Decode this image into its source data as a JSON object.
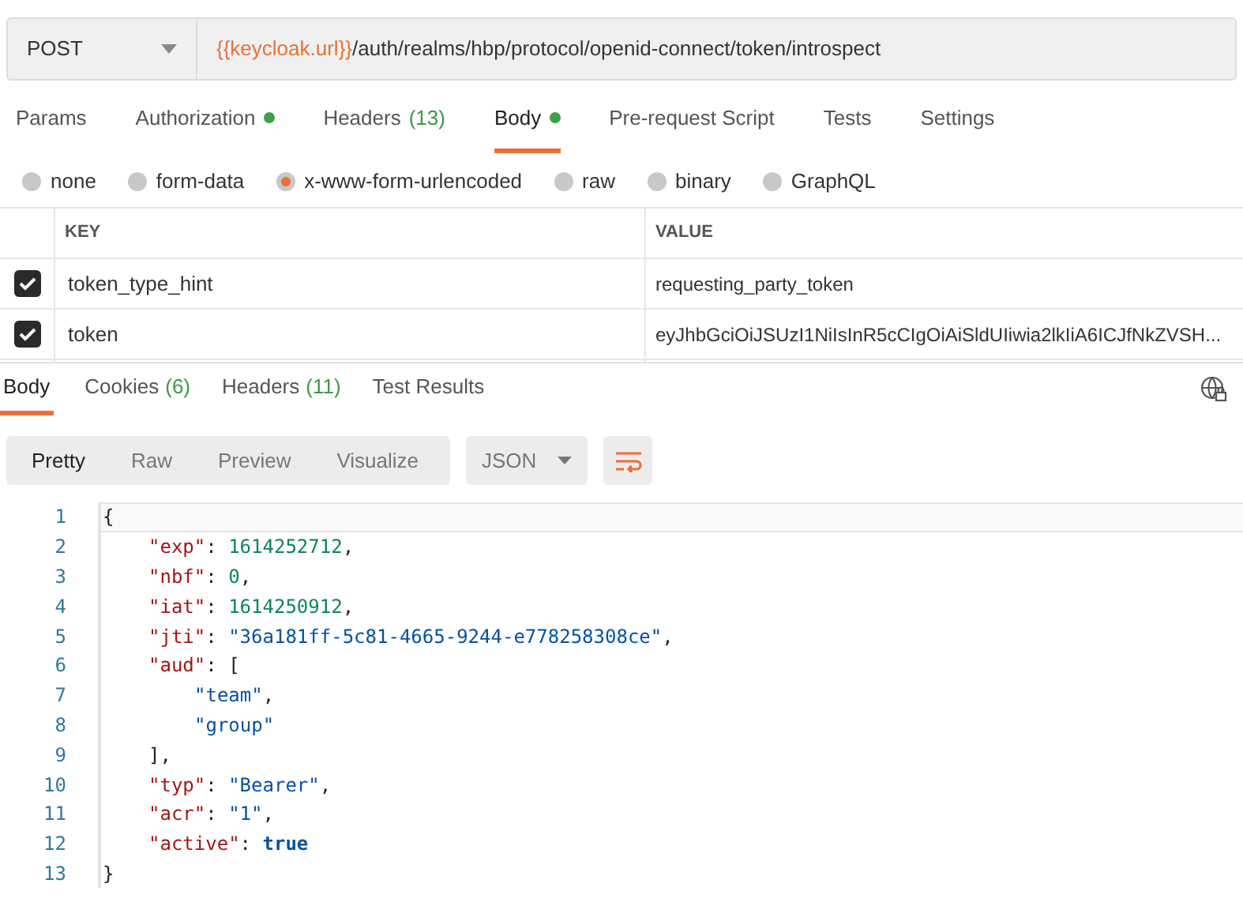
{
  "request": {
    "method": "POST",
    "url_variable": "{{keycloak.url}}",
    "url_path": "/auth/realms/hbp/protocol/openid-connect/token/introspect"
  },
  "request_tabs": [
    {
      "label": "Params",
      "selected": false,
      "dot": false
    },
    {
      "label": "Authorization",
      "selected": false,
      "dot": true
    },
    {
      "label": "Headers",
      "count": "(13)",
      "selected": false,
      "dot": false
    },
    {
      "label": "Body",
      "selected": true,
      "dot": true
    },
    {
      "label": "Pre-request Script",
      "selected": false,
      "dot": false
    },
    {
      "label": "Tests",
      "selected": false,
      "dot": false
    },
    {
      "label": "Settings",
      "selected": false,
      "dot": false
    }
  ],
  "body_types": [
    {
      "label": "none",
      "selected": false
    },
    {
      "label": "form-data",
      "selected": false
    },
    {
      "label": "x-www-form-urlencoded",
      "selected": true
    },
    {
      "label": "raw",
      "selected": false
    },
    {
      "label": "binary",
      "selected": false
    },
    {
      "label": "GraphQL",
      "selected": false
    }
  ],
  "params_table": {
    "columns": [
      "KEY",
      "VALUE"
    ],
    "rows": [
      {
        "checked": true,
        "key": "token_type_hint",
        "value": "requesting_party_token"
      },
      {
        "checked": true,
        "key": "token",
        "value": "eyJhbGciOiJSUzI1NiIsInR5cCIgOiAiSldUIiwia2lkIiA6ICJfNkZVSH..."
      }
    ]
  },
  "response_tabs": [
    {
      "label": "Body",
      "selected": true
    },
    {
      "label": "Cookies",
      "count": "(6)",
      "selected": false
    },
    {
      "label": "Headers",
      "count": "(11)",
      "selected": false
    },
    {
      "label": "Test Results",
      "selected": false
    }
  ],
  "view_modes": [
    {
      "label": "Pretty",
      "selected": true
    },
    {
      "label": "Raw",
      "selected": false
    },
    {
      "label": "Preview",
      "selected": false
    },
    {
      "label": "Visualize",
      "selected": false
    }
  ],
  "format": "JSON",
  "code_lines": [
    {
      "number": "1",
      "tokens": [
        {
          "kind": "punct",
          "text": "{"
        }
      ],
      "children": [
        {
          "number": "2",
          "tokens": [
            {
              "kind": "key",
              "text": "\"exp\""
            },
            {
              "kind": "punct",
              "text": ": "
            },
            {
              "kind": "num",
              "text": "1614252712"
            },
            {
              "kind": "punct",
              "text": ","
            }
          ]
        },
        {
          "number": "3",
          "tokens": [
            {
              "kind": "key",
              "text": "\"nbf\""
            },
            {
              "kind": "punct",
              "text": ": "
            },
            {
              "kind": "num",
              "text": "0"
            },
            {
              "kind": "punct",
              "text": ","
            }
          ]
        },
        {
          "number": "4",
          "tokens": [
            {
              "kind": "key",
              "text": "\"iat\""
            },
            {
              "kind": "punct",
              "text": ": "
            },
            {
              "kind": "num",
              "text": "1614250912"
            },
            {
              "kind": "punct",
              "text": ","
            }
          ]
        },
        {
          "number": "5",
          "tokens": [
            {
              "kind": "key",
              "text": "\"jti\""
            },
            {
              "kind": "punct",
              "text": ": "
            },
            {
              "kind": "str",
              "text": "\"36a181ff-5c81-4665-9244-e778258308ce\""
            },
            {
              "kind": "punct",
              "text": ","
            }
          ]
        },
        {
          "number": "6",
          "tokens": [
            {
              "kind": "key",
              "text": "\"aud\""
            },
            {
              "kind": "punct",
              "text": ": ["
            }
          ],
          "children": [
            {
              "number": "7",
              "tokens": [
                {
                  "kind": "str",
                  "text": "\"team\""
                },
                {
                  "kind": "punct",
                  "text": ","
                }
              ]
            },
            {
              "number": "8",
              "tokens": [
                {
                  "kind": "str",
                  "text": "\"group\""
                }
              ]
            }
          ]
        },
        {
          "number": "9",
          "tokens": [
            {
              "kind": "punct",
              "text": "],"
            }
          ]
        },
        {
          "number": "10",
          "tokens": [
            {
              "kind": "key",
              "text": "\"typ\""
            },
            {
              "kind": "punct",
              "text": ": "
            },
            {
              "kind": "str",
              "text": "\"Bearer\""
            },
            {
              "kind": "punct",
              "text": ","
            }
          ]
        },
        {
          "number": "11",
          "tokens": [
            {
              "kind": "key",
              "text": "\"acr\""
            },
            {
              "kind": "punct",
              "text": ": "
            },
            {
              "kind": "str",
              "text": "\"1\""
            },
            {
              "kind": "punct",
              "text": ","
            }
          ]
        },
        {
          "number": "12",
          "tokens": [
            {
              "kind": "key",
              "text": "\"active\""
            },
            {
              "kind": "punct",
              "text": ": "
            },
            {
              "kind": "bool",
              "text": "true"
            }
          ]
        }
      ]
    },
    {
      "number": "13",
      "tokens": [
        {
          "kind": "punct",
          "text": "}"
        }
      ]
    }
  ]
}
